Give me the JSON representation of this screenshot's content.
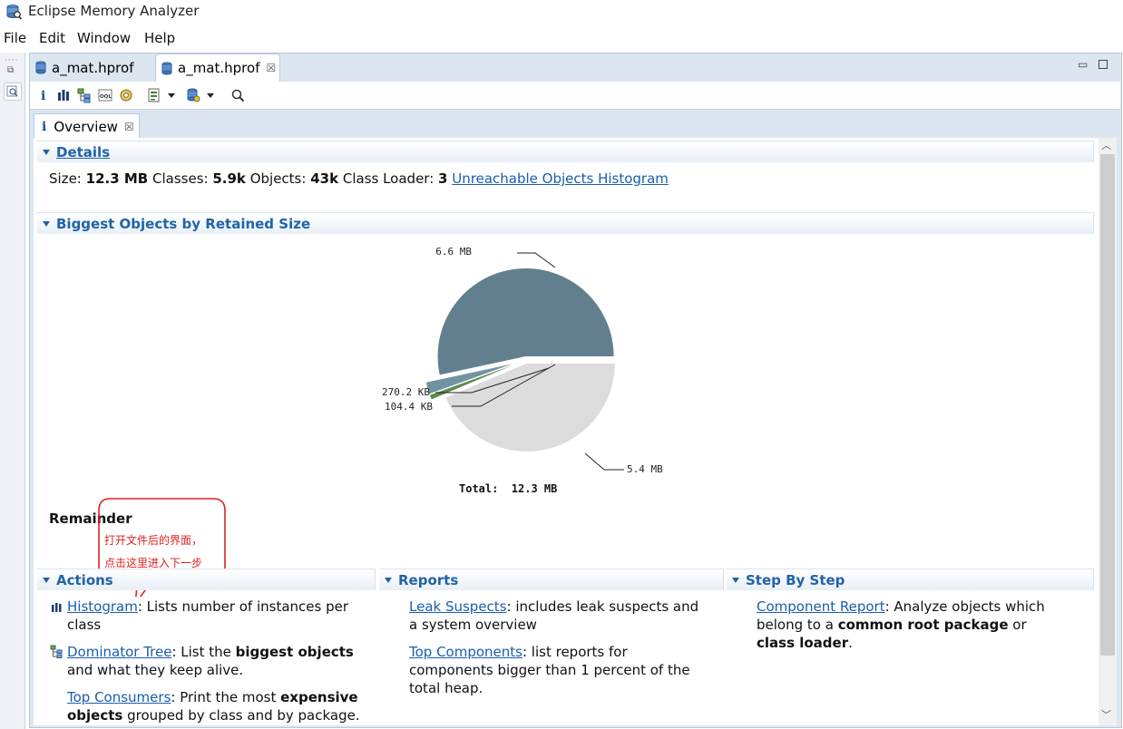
{
  "window": {
    "title": "Eclipse Memory Analyzer"
  },
  "menu": [
    "File",
    "Edit",
    "Window",
    "Help"
  ],
  "editor_tabs": [
    {
      "label": "a_mat.hprof",
      "active": false
    },
    {
      "label": "a_mat.hprof",
      "active": true,
      "close": "☒"
    }
  ],
  "toolbar_icons": [
    "info-icon",
    "histogram-icon",
    "dominator-tree-icon",
    "oql-icon",
    "heap-dump-overview-icon",
    "query-browser-icon",
    "dropdown-icon",
    "group-by-icon",
    "dropdown-icon",
    "search-icon"
  ],
  "overview_tab": {
    "label": "Overview",
    "close": "☒"
  },
  "details": {
    "header": "Details",
    "size_label": "Size:",
    "size_value": "12.3 MB",
    "classes_label": "Classes:",
    "classes_value": "5.9k",
    "objects_label": "Objects:",
    "objects_value": "43k",
    "loader_label": "Class Loader:",
    "loader_value": "3",
    "unreachable_link": "Unreachable Objects Histogram"
  },
  "biggest": {
    "header": "Biggest Objects by Retained Size",
    "total_label": "Total:  12.3 MB",
    "remainder": "Remainder"
  },
  "chart_data": {
    "type": "pie",
    "total": "Total:  12.3 MB",
    "slices": [
      {
        "label": "6.6 MB",
        "value": 6.6,
        "color": "#627f8f"
      },
      {
        "label": "270.2 KB",
        "value": 0.264,
        "color": "#6f93a1"
      },
      {
        "label": "104.4 KB",
        "value": 0.102,
        "color": "#5d8a4e"
      },
      {
        "label": "5.4 MB",
        "value": 5.4,
        "color": "#dcdcdc"
      }
    ]
  },
  "callout": {
    "line1": "打开文件后的界面，",
    "line2": "点击这里进入下一步",
    "color": "#e02020"
  },
  "actions": {
    "header": "Actions",
    "histogram_link": "Histogram",
    "histogram_text": ": Lists number of instances per class",
    "dominator_link": "Dominator Tree",
    "dominator_text1": ": List the ",
    "dominator_bold": "biggest objects",
    "dominator_text2": " and what they keep alive.",
    "consumers_link": "Top Consumers",
    "consumers_text1": ": Print the most ",
    "consumers_bold": "expensive objects",
    "consumers_text2": " grouped by class and by package."
  },
  "reports": {
    "header": "Reports",
    "leak_link": "Leak Suspects",
    "leak_text": ": includes leak suspects and a system overview",
    "top_link": "Top Components",
    "top_text": ": list reports for components bigger than 1 percent of the total heap."
  },
  "steps": {
    "header": "Step By Step",
    "component_link": "Component Report",
    "component_text1": ": Analyze objects which belong to a ",
    "component_bold1": "common root package",
    "component_text2": " or ",
    "component_bold2": "class loader",
    "component_text3": "."
  },
  "colors": {
    "accent": "#1f63a8",
    "link": "#1a5dad",
    "tab_bg": "#dbe6f1"
  }
}
